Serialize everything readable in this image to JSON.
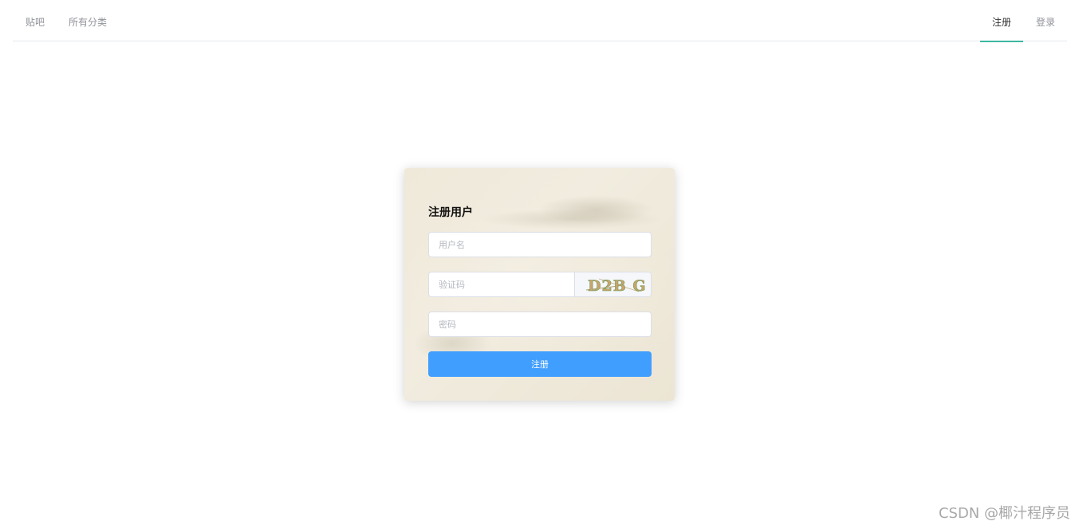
{
  "nav": {
    "left": [
      "贴吧",
      "所有分类"
    ],
    "register": "注册",
    "login": "登录",
    "active_color": "#3cb8a0"
  },
  "form": {
    "title": "注册用户",
    "username_placeholder": "用户名",
    "captcha_placeholder": "验证码",
    "captcha_text": "D2B G",
    "password_placeholder": "密码",
    "submit_label": "注册",
    "submit_color": "#409eff"
  },
  "watermark": "CSDN @椰汁程序员"
}
